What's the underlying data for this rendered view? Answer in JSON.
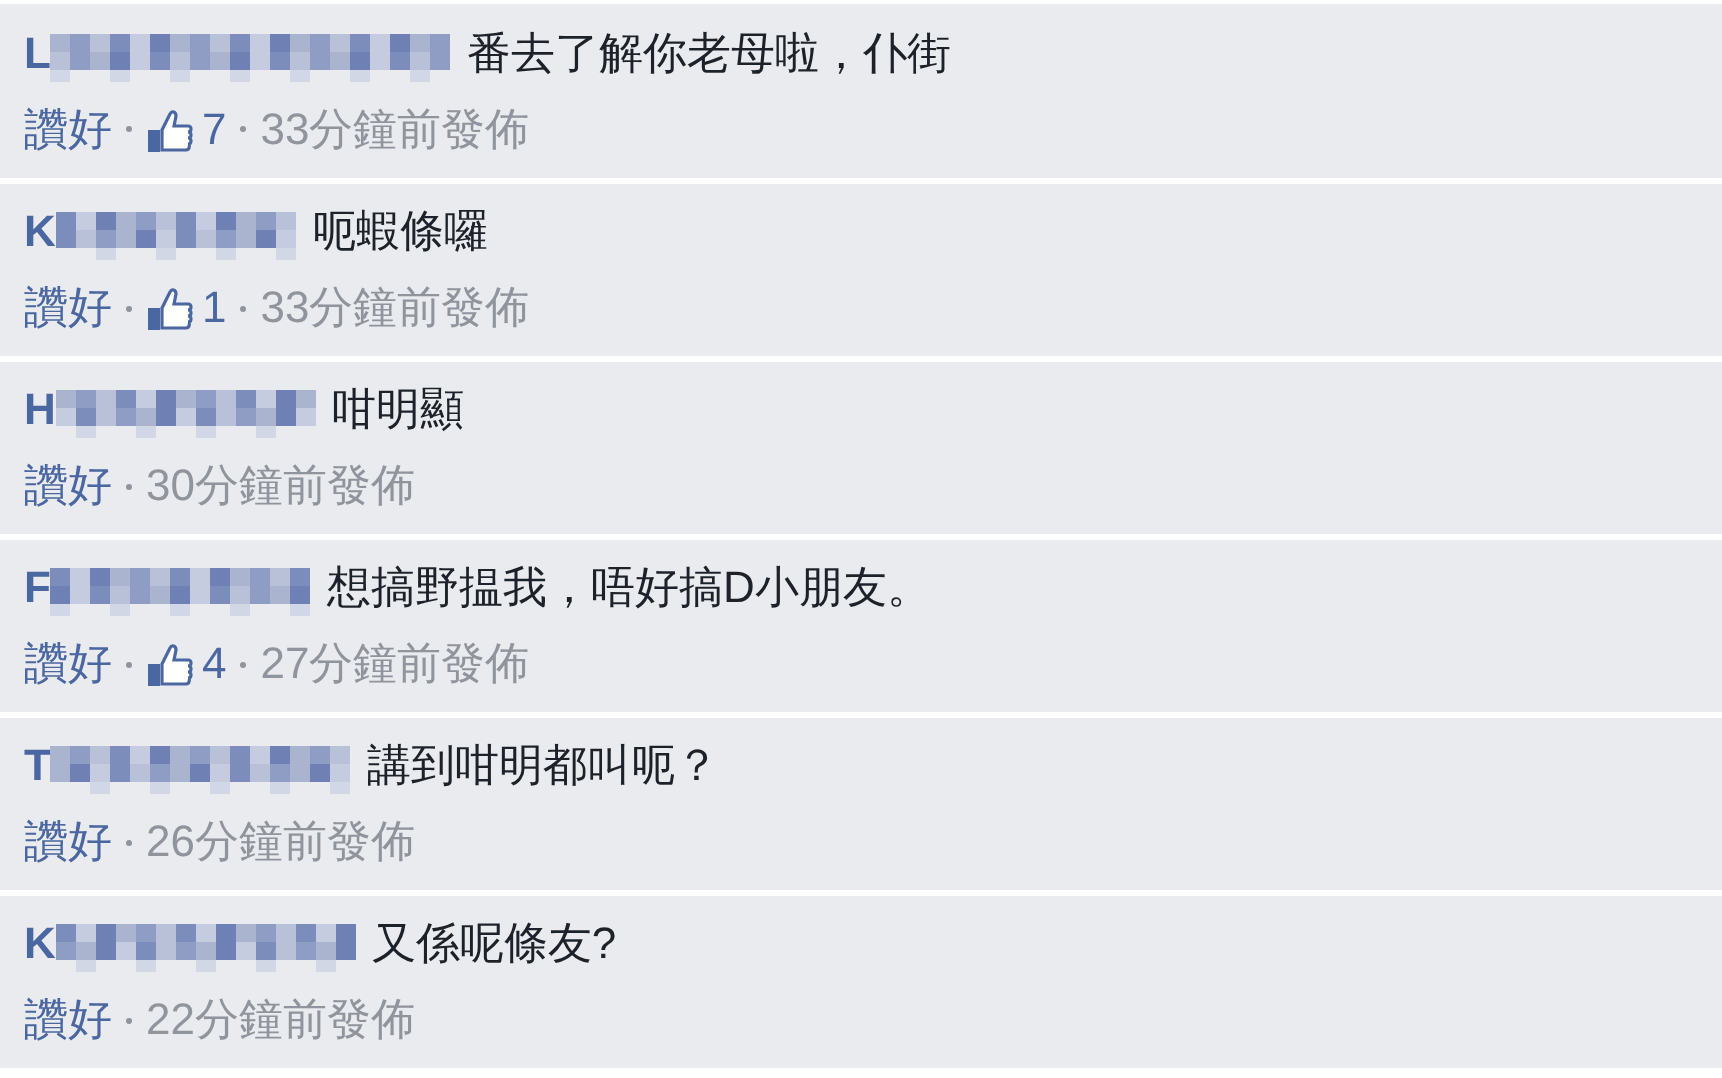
{
  "comments": [
    {
      "author": "L",
      "text": "番去了解你老母啦，仆街",
      "like_label": "讚好",
      "likes": "7",
      "time": "33分鐘前發佈"
    },
    {
      "author": "K",
      "text": "呃蝦條囉",
      "like_label": "讚好",
      "likes": "1",
      "time": "33分鐘前發佈"
    },
    {
      "author": "H",
      "text": "咁明顯",
      "like_label": "讚好",
      "time": "30分鐘前發佈"
    },
    {
      "author": "F",
      "text": "想搞野揾我，唔好搞D小朋友。",
      "like_label": "讚好",
      "likes": "4",
      "time": "27分鐘前發佈"
    },
    {
      "author": "T",
      "text": "講到咁明都叫呃？",
      "like_label": "讚好",
      "time": "26分鐘前發佈"
    },
    {
      "author": "K",
      "text": "又係呢條友?",
      "like_label": "讚好",
      "time": "22分鐘前發佈"
    }
  ]
}
